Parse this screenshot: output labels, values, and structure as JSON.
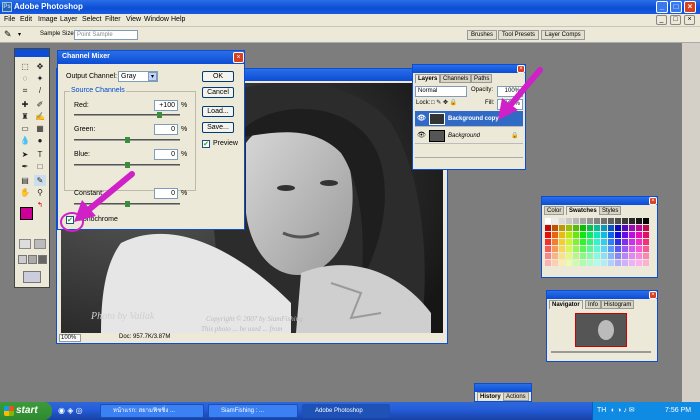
{
  "app": {
    "title": "Adobe Photoshop"
  },
  "menu": [
    "File",
    "Edit",
    "Image",
    "Layer",
    "Select",
    "Filter",
    "View",
    "Window",
    "Help"
  ],
  "options_bar": {
    "sample_size_label": "Sample Size:",
    "sample_size_value": "Point Sample",
    "well_tabs": [
      "Brushes",
      "Tool Presets",
      "Layer Comps"
    ]
  },
  "channel_mixer": {
    "title": "Channel Mixer",
    "output_channel_label": "Output Channel:",
    "output_channel_value": "Gray",
    "source_channels_label": "Source Channels",
    "red_label": "Red:",
    "red_value": "+100",
    "green_label": "Green:",
    "green_value": "0",
    "blue_label": "Blue:",
    "blue_value": "0",
    "constant_label": "Constant:",
    "constant_value": "0",
    "percent": "%",
    "monochrome_label": "Monochrome",
    "monochrome_checked": true,
    "preview_label": "Preview",
    "preview_checked": true,
    "buttons": {
      "ok": "OK",
      "cancel": "Cancel",
      "load": "Load...",
      "save": "Save..."
    }
  },
  "document": {
    "zoom": "100%",
    "doc_info": "Doc: 957.7K/3.87M",
    "watermark_1": "Photo by Vailak",
    "watermark_2": "Copyright © 2007 by SiamFishing",
    "watermark_3": "This photo ... be used ... from"
  },
  "layers_panel": {
    "tabs": [
      "Layers",
      "Channels",
      "Paths"
    ],
    "blend_mode": "Normal",
    "opacity_label": "Opacity:",
    "opacity_value": "100%",
    "lock_label": "Lock:",
    "fill_label": "Fill:",
    "fill_value": "100%",
    "layers": [
      {
        "name": "Background copy",
        "selected": true
      },
      {
        "name": "Background",
        "selected": false
      }
    ]
  },
  "swatches_panel": {
    "tabs": [
      "Color",
      "Swatches",
      "Styles"
    ]
  },
  "navigator_panel": {
    "tabs": [
      "Navigator",
      "Info",
      "Histogram"
    ]
  },
  "history_panel": {
    "tabs": [
      "History",
      "Actions"
    ]
  },
  "taskbar": {
    "start_label": "start",
    "tasks": [
      "หน้าแรก: สยามฟิชชิ่ง ...",
      "SiamFishing : ...",
      "Adobe Photoshop"
    ],
    "language": "TH",
    "clock": "7:56 PM"
  },
  "colors": {
    "title_blue": "#0b4dd4",
    "annotation_magenta": "#d020c8",
    "foreground_swatch": "#cc0099"
  }
}
